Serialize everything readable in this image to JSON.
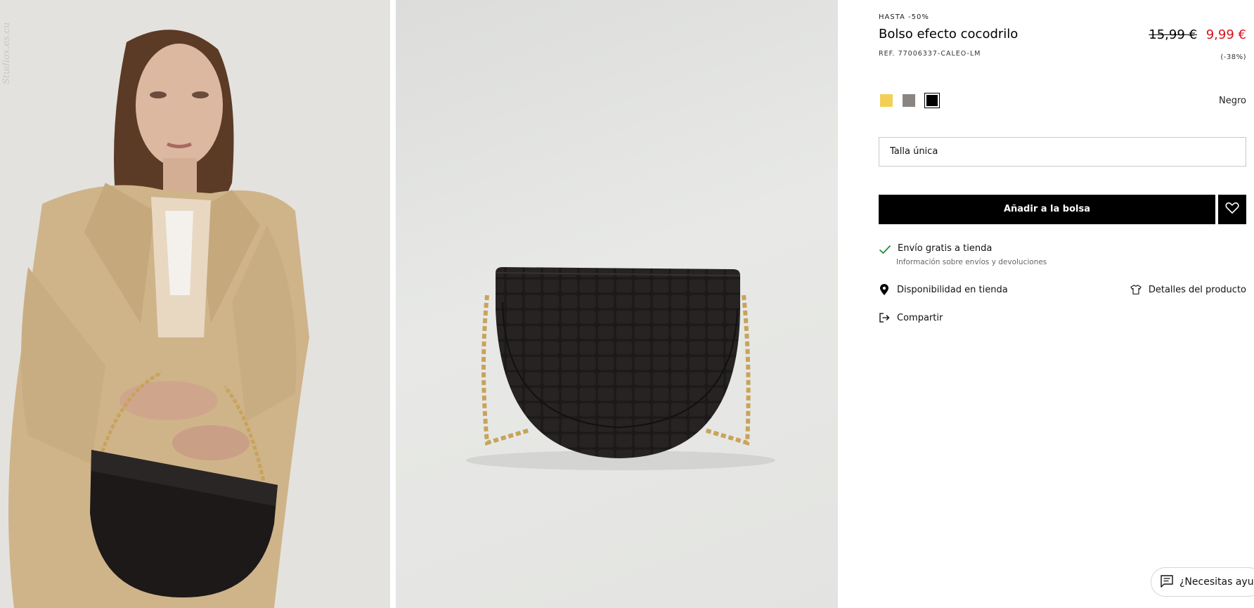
{
  "gallery": {
    "images": [
      {
        "alt": "model-with-bag-photo"
      },
      {
        "alt": "bag-product-photo"
      }
    ],
    "watermark": "Studiox.es.cu"
  },
  "product": {
    "promo": "HASTA -50%",
    "name": "Bolso efecto cocodrilo",
    "ref": "REF. 77006337-CALEO-LM",
    "price_old": "15,99 €",
    "price_new": "9,99 €",
    "discount": "(-38%)",
    "colors": [
      {
        "name": "yellow",
        "hex": "#f3cf57",
        "selected": false
      },
      {
        "name": "grey",
        "hex": "#8a8580",
        "selected": false
      },
      {
        "name": "black",
        "hex": "#000000",
        "selected": true
      }
    ],
    "selected_color": "Negro",
    "size": "Talla única",
    "add_to_bag": "Añadir a la bolsa",
    "favorite_icon": "heart-icon"
  },
  "shipping": {
    "label": "Envío gratis a tienda",
    "info_link": "Información sobre envíos y devoluciones",
    "icon": "check-icon",
    "accent": "#1e8e3e"
  },
  "links": {
    "store_availability": "Disponibilidad en tienda",
    "product_details": "Detalles del producto",
    "share": "Compartir"
  },
  "help": {
    "label": "¿Necesitas ayuda?"
  },
  "colors": {
    "sale_red": "#d6121a",
    "button_black": "#000000"
  }
}
